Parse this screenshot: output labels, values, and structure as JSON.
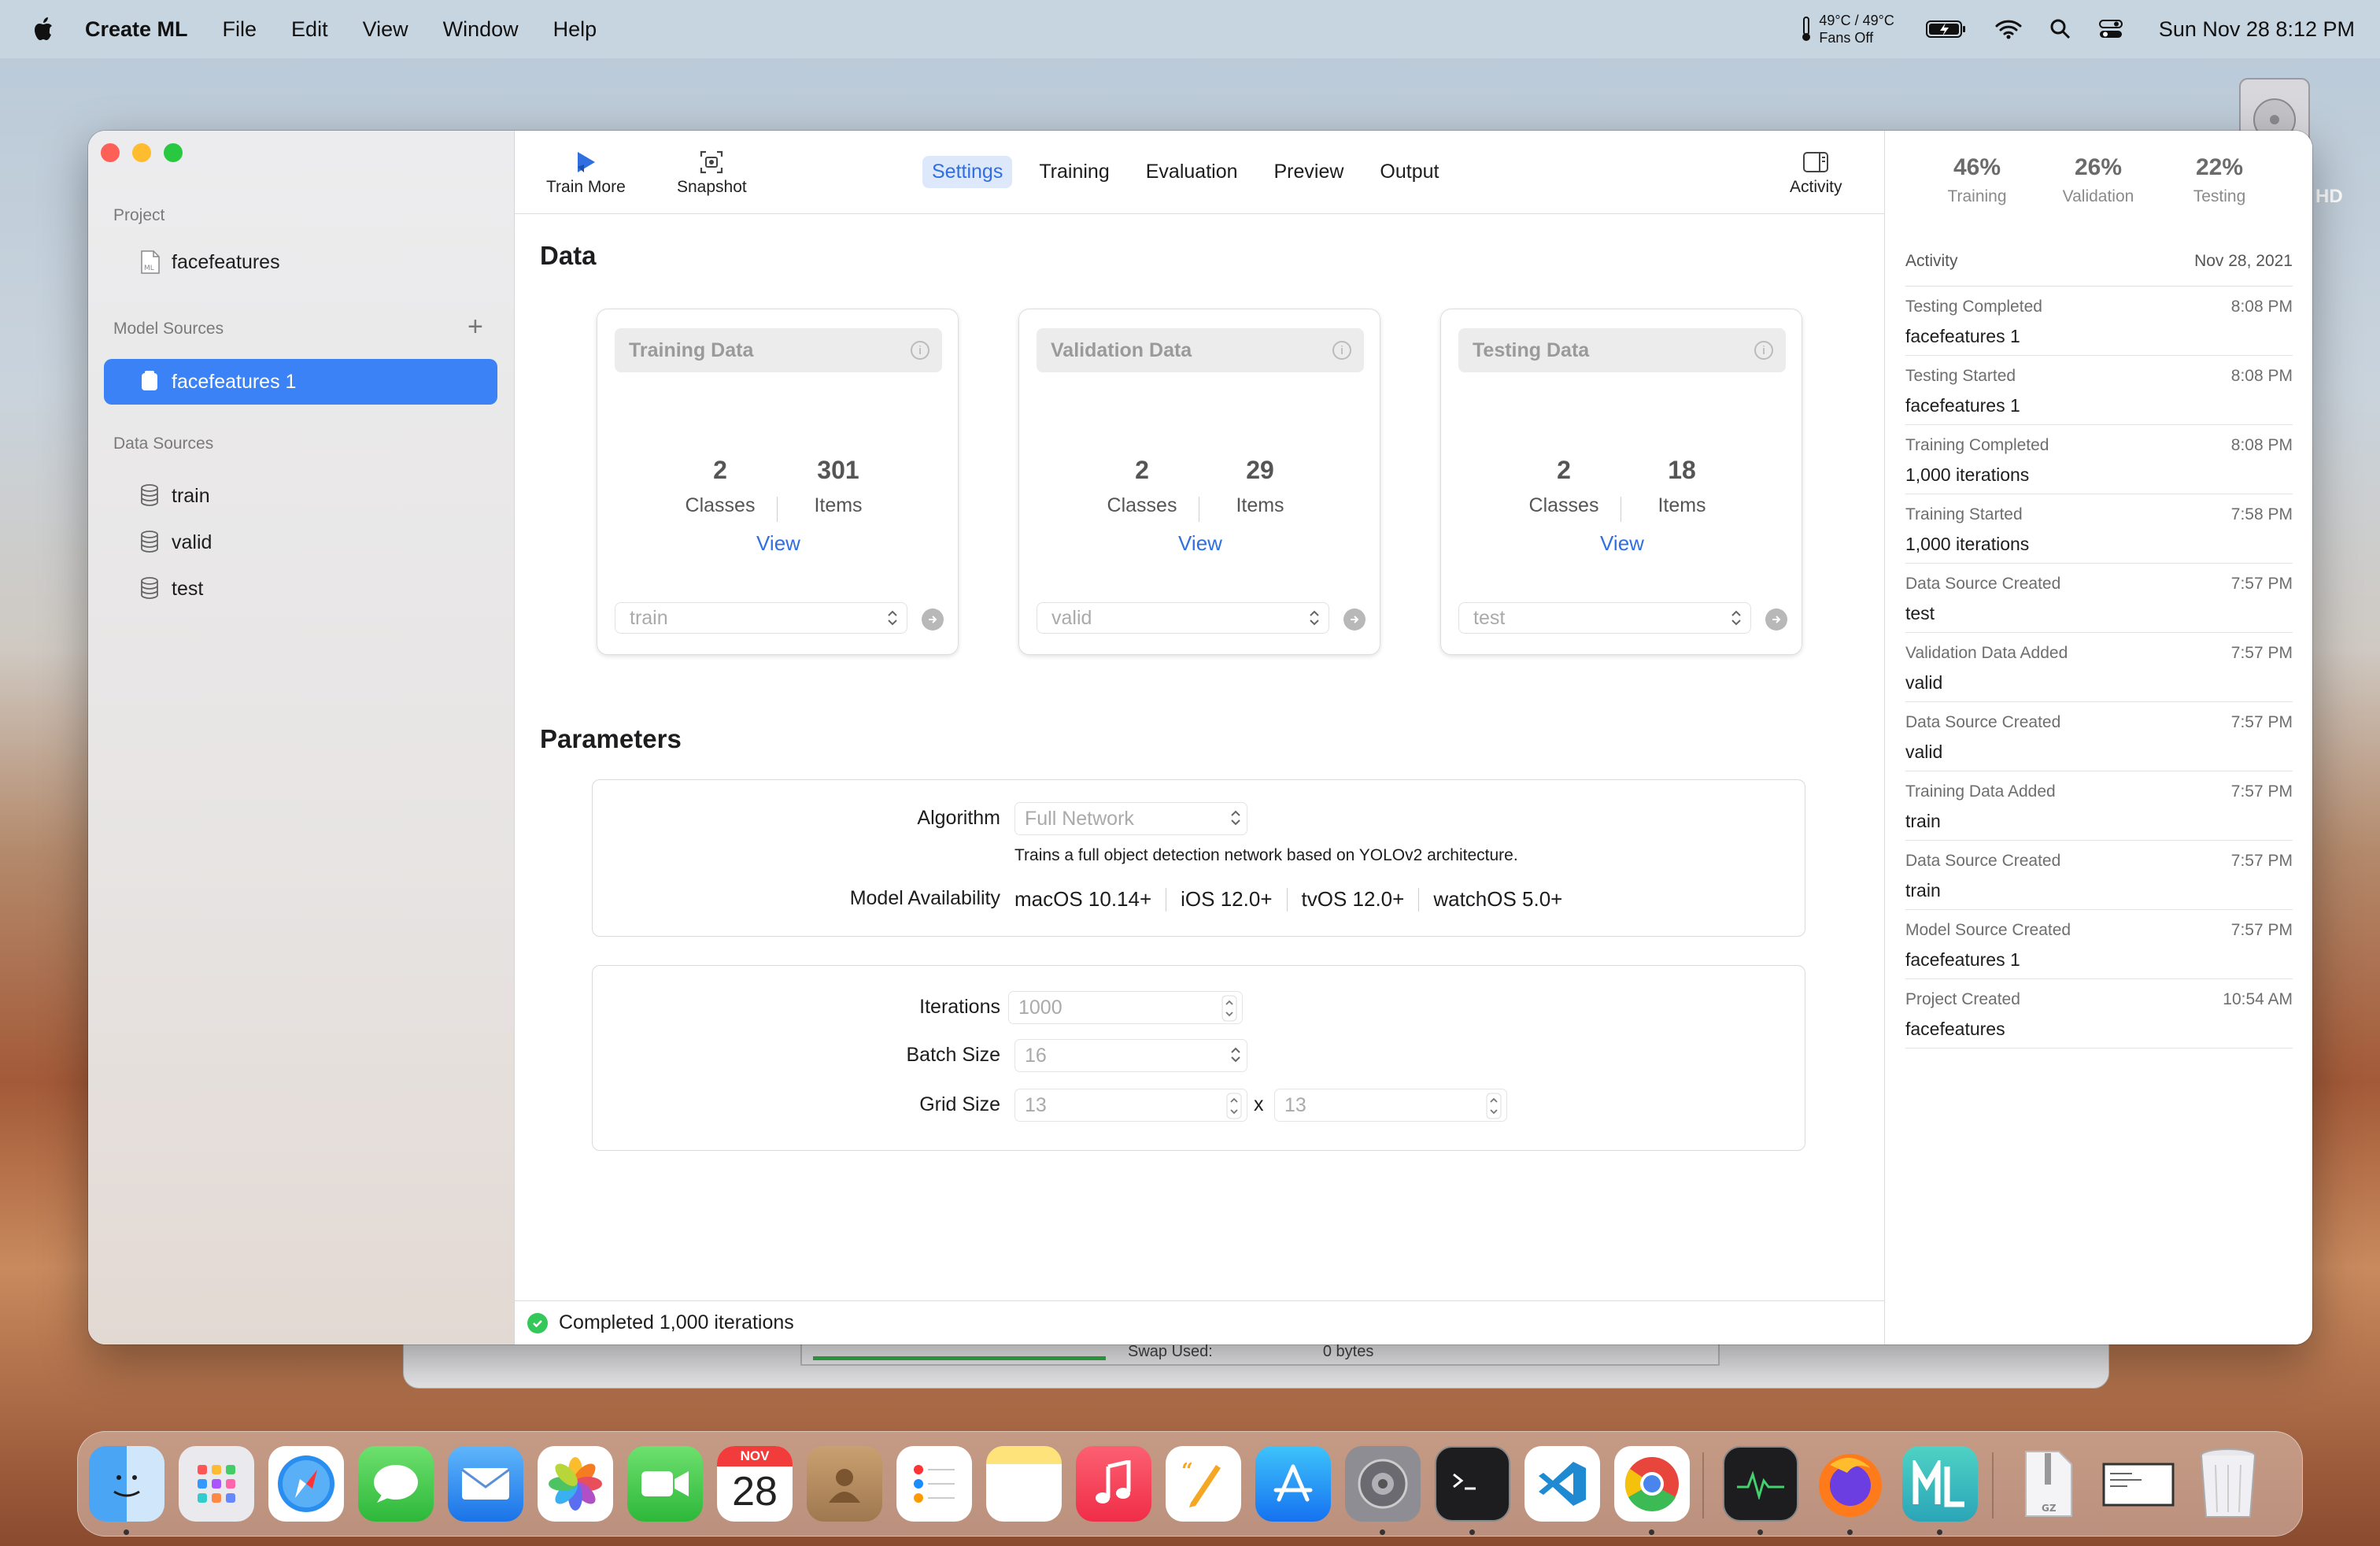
{
  "menubar": {
    "app_name": "Create ML",
    "menus": [
      "File",
      "Edit",
      "View",
      "Window",
      "Help"
    ],
    "temp_line1": "49°C / 49°C",
    "temp_line2": "Fans Off",
    "clock": "Sun Nov 28  8:12 PM"
  },
  "desktop": {
    "drive_label": "HD",
    "bg_window_text": "Swap Used:",
    "bg_window_value": "0 bytes"
  },
  "sidebar": {
    "project_header": "Project",
    "project_name": "facefeatures",
    "model_sources_header": "Model Sources",
    "model_source": "facefeatures 1",
    "data_sources_header": "Data Sources",
    "data_sources": [
      "train",
      "valid",
      "test"
    ]
  },
  "toolbar": {
    "train_more": "Train More",
    "snapshot": "Snapshot",
    "tabs": [
      "Settings",
      "Training",
      "Evaluation",
      "Preview",
      "Output"
    ],
    "active_tab": "Settings",
    "activity": "Activity"
  },
  "data_section": {
    "title": "Data",
    "cards": [
      {
        "title": "Training Data",
        "classes": "2",
        "classes_label": "Classes",
        "items": "301",
        "items_label": "Items",
        "view": "View",
        "source": "train"
      },
      {
        "title": "Validation Data",
        "classes": "2",
        "classes_label": "Classes",
        "items": "29",
        "items_label": "Items",
        "view": "View",
        "source": "valid"
      },
      {
        "title": "Testing Data",
        "classes": "2",
        "classes_label": "Classes",
        "items": "18",
        "items_label": "Items",
        "view": "View",
        "source": "test"
      }
    ]
  },
  "parameters": {
    "title": "Parameters",
    "algorithm_label": "Algorithm",
    "algorithm_value": "Full Network",
    "algorithm_desc": "Trains a full object detection network based on YOLOv2 architecture.",
    "availability_label": "Model Availability",
    "availability": [
      "macOS 10.14+",
      "iOS 12.0+",
      "tvOS 12.0+",
      "watchOS 5.0+"
    ],
    "iterations_label": "Iterations",
    "iterations_value": "1000",
    "batch_label": "Batch Size",
    "batch_value": "16",
    "grid_label": "Grid Size",
    "grid_w": "13",
    "grid_h": "13",
    "grid_sep": "x"
  },
  "status": {
    "text": "Completed 1,000 iterations",
    "color": "#34c759"
  },
  "activity_panel": {
    "splits": [
      {
        "value": "46%",
        "label": "Training"
      },
      {
        "value": "26%",
        "label": "Validation"
      },
      {
        "value": "22%",
        "label": "Testing"
      }
    ],
    "header": "Activity",
    "date": "Nov 28, 2021",
    "events": [
      {
        "title": "Testing Completed",
        "time": "8:08 PM",
        "detail": "facefeatures 1"
      },
      {
        "title": "Testing Started",
        "time": "8:08 PM",
        "detail": "facefeatures 1"
      },
      {
        "title": "Training Completed",
        "time": "8:08 PM",
        "detail": "1,000 iterations"
      },
      {
        "title": "Training Started",
        "time": "7:58 PM",
        "detail": "1,000 iterations"
      },
      {
        "title": "Data Source Created",
        "time": "7:57 PM",
        "detail": "test"
      },
      {
        "title": "Validation Data Added",
        "time": "7:57 PM",
        "detail": "valid"
      },
      {
        "title": "Data Source Created",
        "time": "7:57 PM",
        "detail": "valid"
      },
      {
        "title": "Training Data Added",
        "time": "7:57 PM",
        "detail": "train"
      },
      {
        "title": "Data Source Created",
        "time": "7:57 PM",
        "detail": "train"
      },
      {
        "title": "Model Source Created",
        "time": "7:57 PM",
        "detail": "facefeatures 1"
      },
      {
        "title": "Project Created",
        "time": "10:54 AM",
        "detail": "facefeatures"
      }
    ]
  },
  "dock": {
    "calendar_month": "NOV",
    "calendar_day": "28",
    "apps": [
      "finder-icon",
      "launchpad-icon",
      "safari-icon",
      "messages-icon",
      "mail-icon",
      "photos-icon",
      "facetime-icon",
      "calendar-icon",
      "contacts-icon",
      "reminders-icon",
      "notes-icon",
      "music-icon",
      "pages-icon",
      "app-store-icon",
      "system-preferences-icon",
      "terminal-icon",
      "vscode-icon",
      "chrome-icon",
      "activity-monitor-icon",
      "firefox-icon",
      "create-ml-icon",
      "archive-icon",
      "screenshot-icon",
      "trash-icon"
    ]
  },
  "colors": {
    "accent": "#3a82f6",
    "link": "#2f6fe0",
    "selection": "#3a82f6"
  }
}
